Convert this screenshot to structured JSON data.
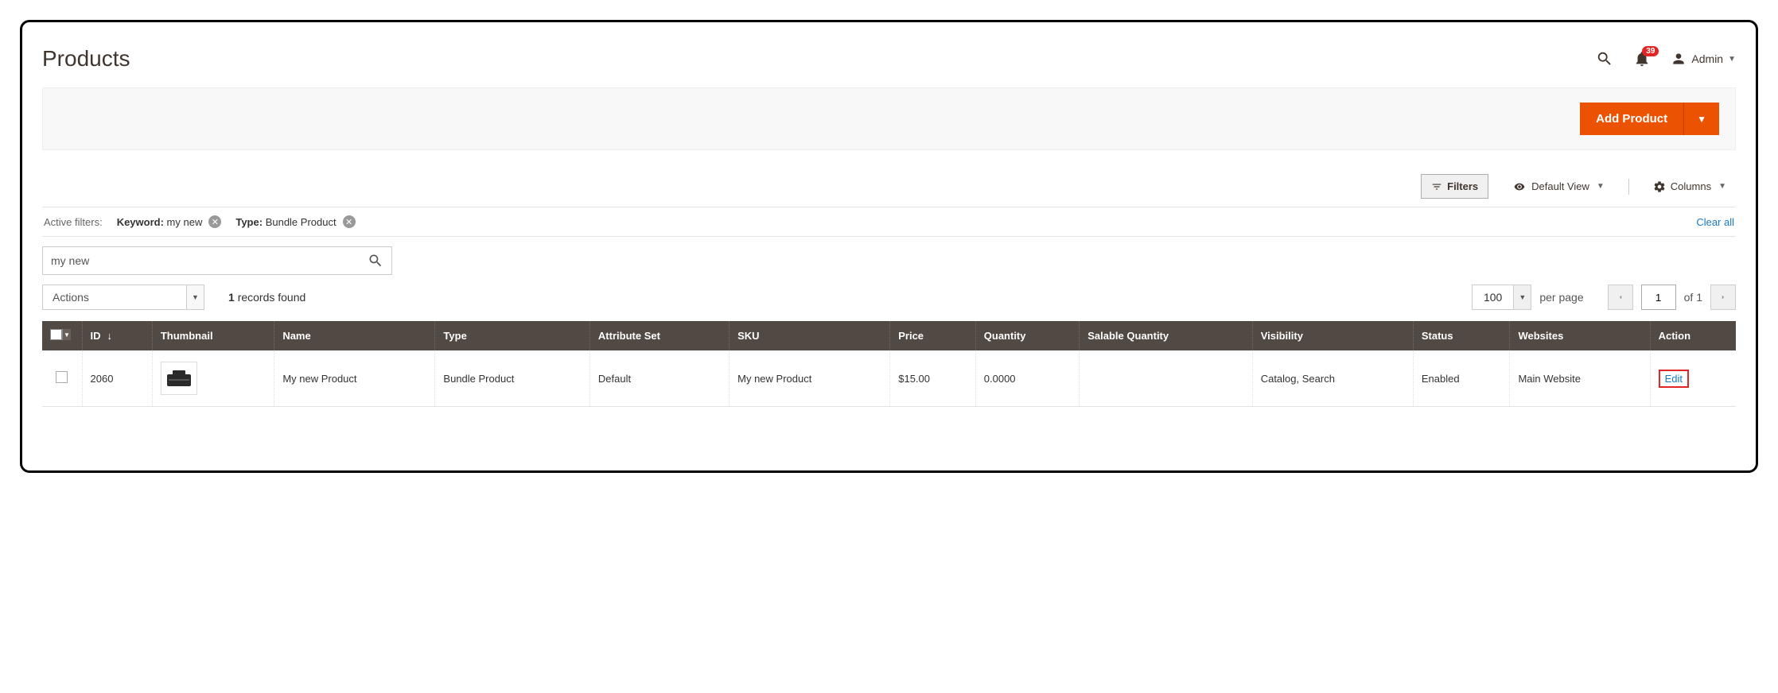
{
  "header": {
    "title": "Products",
    "notif_count": "39",
    "admin_label": "Admin"
  },
  "primary_action": {
    "label": "Add Product"
  },
  "toolbar": {
    "filters": "Filters",
    "default_view": "Default View",
    "columns": "Columns"
  },
  "active_filters": {
    "label": "Active filters:",
    "chips": [
      {
        "key": "Keyword:",
        "value": "my new"
      },
      {
        "key": "Type:",
        "value": "Bundle Product"
      }
    ],
    "clear_all": "Clear all"
  },
  "search": {
    "value": "my new"
  },
  "bulk": {
    "actions_label": "Actions",
    "records_count": "1",
    "records_label": "records found"
  },
  "pager": {
    "per_page_value": "100",
    "per_page_label": "per page",
    "page": "1",
    "of_label": "of",
    "total_pages": "1"
  },
  "columns_hdr": {
    "id": "ID",
    "thumbnail": "Thumbnail",
    "name": "Name",
    "type": "Type",
    "attribute_set": "Attribute Set",
    "sku": "SKU",
    "price": "Price",
    "quantity": "Quantity",
    "salable_quantity": "Salable Quantity",
    "visibility": "Visibility",
    "status": "Status",
    "websites": "Websites",
    "action": "Action"
  },
  "rows": [
    {
      "id": "2060",
      "name": "My new Product",
      "type": "Bundle Product",
      "attribute_set": "Default",
      "sku": "My new Product",
      "price": "$15.00",
      "quantity": "0.0000",
      "salable_quantity": "",
      "visibility": "Catalog, Search",
      "status": "Enabled",
      "websites": "Main Website",
      "action": "Edit"
    }
  ]
}
